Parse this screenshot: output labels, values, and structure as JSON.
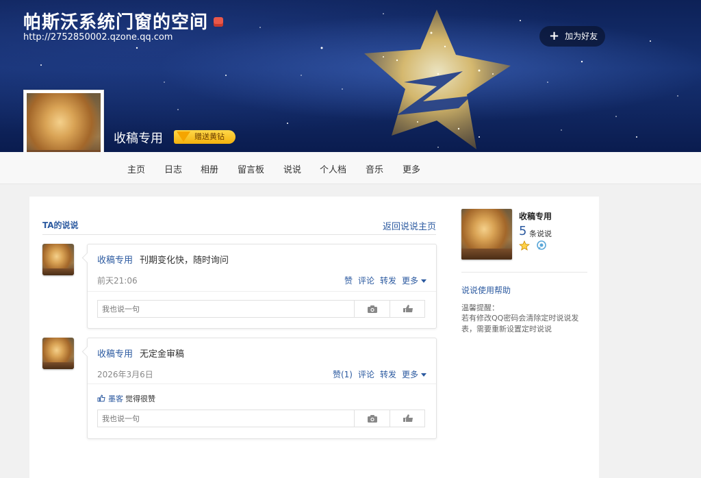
{
  "header": {
    "space_title": "帕斯沃系统门窗的空间",
    "space_url": "http://2752850002.qzone.qq.com",
    "add_friend_label": "加为好友",
    "owner_name": "收稿专用",
    "vip_badge_label": "赠送黄钻"
  },
  "nav": {
    "items": [
      {
        "label": "主页"
      },
      {
        "label": "日志"
      },
      {
        "label": "相册"
      },
      {
        "label": "留言板"
      },
      {
        "label": "说说"
      },
      {
        "label": "个人档"
      },
      {
        "label": "音乐"
      },
      {
        "label": "更多"
      }
    ]
  },
  "section": {
    "title": "TA的说说",
    "back_link": "返回说说主页"
  },
  "feeds": [
    {
      "author": "收稿专用",
      "text": "刊期变化快，随时询问",
      "time": "前天21:06",
      "like_label": "赞",
      "comment_label": "评论",
      "forward_label": "转发",
      "more_label": "更多",
      "comment_placeholder": "我也说一句"
    },
    {
      "author": "收稿专用",
      "text": "无定金审稿",
      "time": "2026年3月6日",
      "like_label": "赞(1)",
      "comment_label": "评论",
      "forward_label": "转发",
      "more_label": "更多",
      "liker_name": "墨客",
      "liker_suffix": "觉得很赞",
      "comment_placeholder": "我也说一句"
    }
  ],
  "sidebar": {
    "name": "收稿专用",
    "count": "5",
    "count_label": "条说说",
    "help_link": "说说使用帮助",
    "tip_title": "温馨提醒：",
    "tip_text": "若有修改QQ密码会清除定时说说发表，需要重新设置定时说说"
  },
  "colors": {
    "link": "#2c5aa0",
    "banner": "#163172",
    "vip": "#f3b10d"
  },
  "icons": [
    "plus-icon",
    "gift-icon",
    "diamond-icon",
    "camera-icon",
    "thumb-icon",
    "star-icon",
    "qzone-icon"
  ]
}
